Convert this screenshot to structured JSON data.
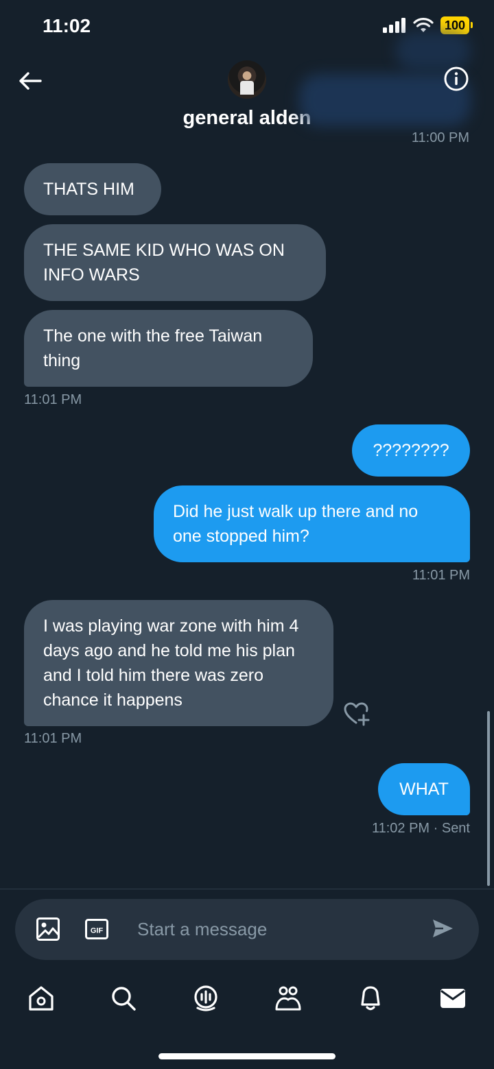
{
  "status_bar": {
    "time": "11:02",
    "battery": "100"
  },
  "header": {
    "contact_name": "general alden",
    "previous_timestamp": "11:00 PM"
  },
  "messages": [
    {
      "direction": "in",
      "text": "THATS HIM"
    },
    {
      "direction": "in",
      "text": "THE SAME KID WHO WAS ON INFO WARS"
    },
    {
      "direction": "in",
      "text": "The one with the free Taiwan thing"
    },
    {
      "timestamp": "11:01 PM"
    },
    {
      "direction": "out",
      "text": "????????"
    },
    {
      "direction": "out",
      "text": "Did he just walk up there and no one stopped him?"
    },
    {
      "timestamp": "11:01 PM"
    },
    {
      "direction": "in",
      "text": "I was playing war zone with him 4 days ago and he told me his plan and I told him there was zero chance it happens"
    },
    {
      "timestamp": "11:01 PM"
    },
    {
      "direction": "out",
      "text": "WHAT"
    },
    {
      "timestamp": "11:02 PM · Sent"
    }
  ],
  "composer": {
    "placeholder": "Start a message",
    "gif_label": "GIF"
  },
  "icons": {
    "back": "arrow-left-icon",
    "info": "info-icon",
    "image": "image-icon",
    "gif": "gif-icon",
    "send": "send-icon",
    "react": "heart-plus-icon",
    "tabs": [
      "home-icon",
      "search-icon",
      "spaces-icon",
      "communities-icon",
      "notifications-icon",
      "messages-icon"
    ]
  },
  "colors": {
    "background": "#15202b",
    "incoming_bubble": "#435261",
    "outgoing_bubble": "#1d9bf0",
    "muted_text": "#8899a6"
  }
}
